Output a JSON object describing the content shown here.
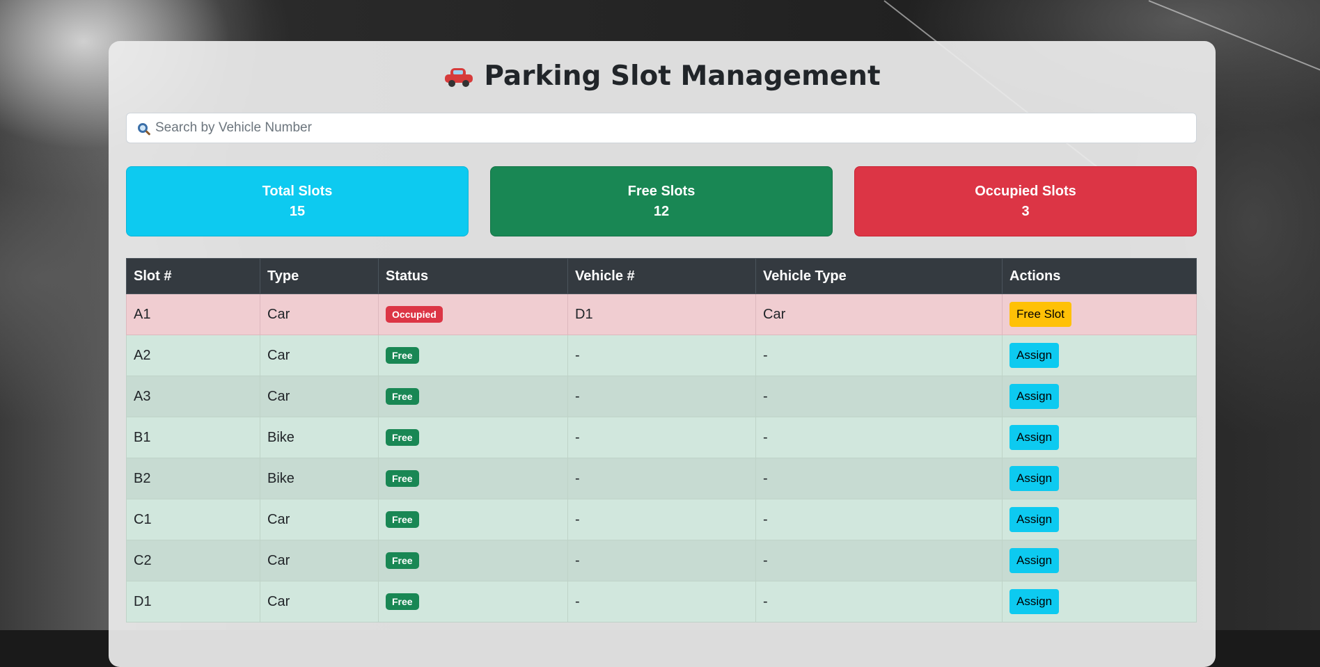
{
  "header": {
    "title": "Parking Slot Management"
  },
  "search": {
    "placeholder": "Search by Vehicle Number"
  },
  "stats": {
    "total_label": "Total Slots",
    "total_value": "15",
    "free_label": "Free Slots",
    "free_value": "12",
    "occupied_label": "Occupied Slots",
    "occupied_value": "3"
  },
  "table": {
    "headers": [
      "Slot #",
      "Type",
      "Status",
      "Vehicle #",
      "Vehicle Type",
      "Actions"
    ],
    "rows": [
      {
        "slot": "A1",
        "type": "Car",
        "status": "Occupied",
        "vehicle": "D1",
        "vehicle_type": "Car",
        "action": "Free Slot"
      },
      {
        "slot": "A2",
        "type": "Car",
        "status": "Free",
        "vehicle": "-",
        "vehicle_type": "-",
        "action": "Assign"
      },
      {
        "slot": "A3",
        "type": "Car",
        "status": "Free",
        "vehicle": "-",
        "vehicle_type": "-",
        "action": "Assign"
      },
      {
        "slot": "B1",
        "type": "Bike",
        "status": "Free",
        "vehicle": "-",
        "vehicle_type": "-",
        "action": "Assign"
      },
      {
        "slot": "B2",
        "type": "Bike",
        "status": "Free",
        "vehicle": "-",
        "vehicle_type": "-",
        "action": "Assign"
      },
      {
        "slot": "C1",
        "type": "Car",
        "status": "Free",
        "vehicle": "-",
        "vehicle_type": "-",
        "action": "Assign"
      },
      {
        "slot": "C2",
        "type": "Car",
        "status": "Free",
        "vehicle": "-",
        "vehicle_type": "-",
        "action": "Assign"
      },
      {
        "slot": "D1",
        "type": "Car",
        "status": "Free",
        "vehicle": "-",
        "vehicle_type": "-",
        "action": "Assign"
      }
    ]
  },
  "colors": {
    "total": "#0dcaf0",
    "free": "#198754",
    "occupied": "#dc3545",
    "table_header": "#343a40",
    "free_slot_button": "#ffc107",
    "assign_button": "#0dcaf0"
  }
}
